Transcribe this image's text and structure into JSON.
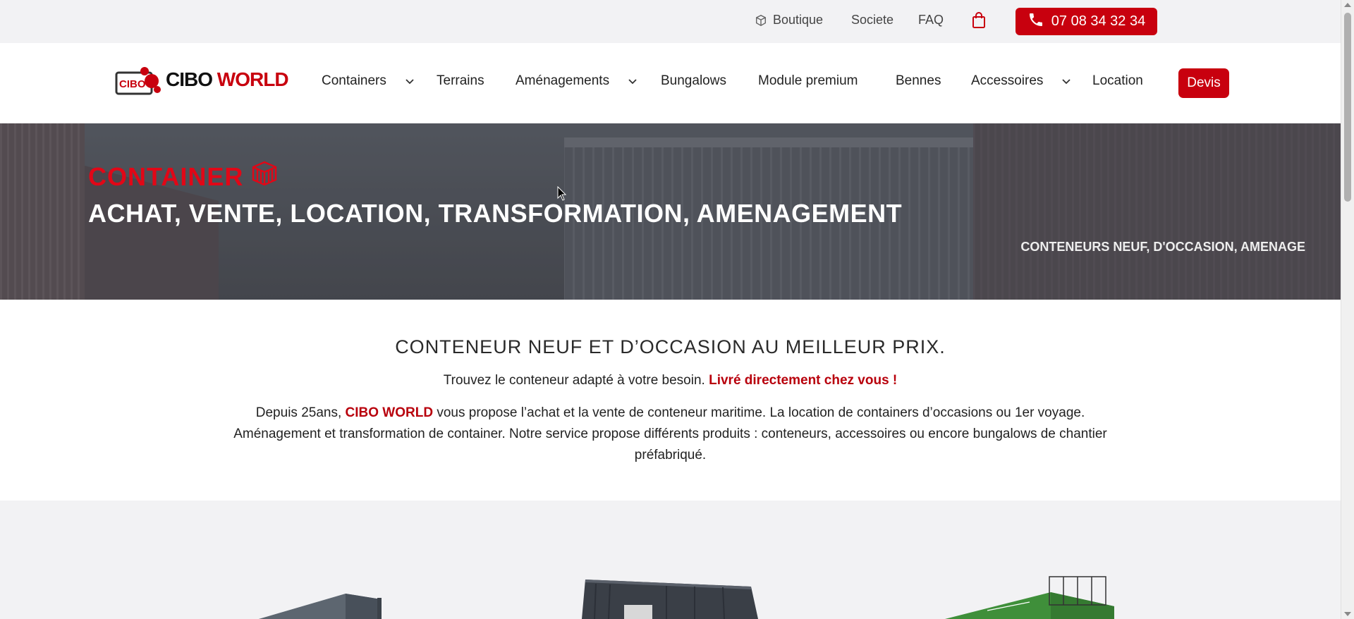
{
  "topbar": {
    "boutique_label": "Boutique",
    "societe_label": "Societe",
    "faq_label": "FAQ",
    "phone_label": "07 08 34 32 34"
  },
  "logo": {
    "badge_text": "CIBO",
    "word1": "CIBO",
    "word2": "WORLD"
  },
  "nav": {
    "items": [
      {
        "label": "Containers",
        "dropdown": true
      },
      {
        "label": "Terrains",
        "dropdown": false
      },
      {
        "label": "Aménagements",
        "dropdown": true
      },
      {
        "label": "Bungalows",
        "dropdown": false
      },
      {
        "label": "Module premium",
        "dropdown": false
      },
      {
        "label": "Bennes",
        "dropdown": false
      },
      {
        "label": "Accessoires",
        "dropdown": true
      },
      {
        "label": "Location",
        "dropdown": false
      }
    ],
    "devis_label": "Devis"
  },
  "hero": {
    "title": "CONTAINER",
    "subtitle": "ACHAT, VENTE, LOCATION, TRANSFORMATION, AMENAGEMENT",
    "tagline": "CONTENEURS NEUF, D'OCCASION, AMENAGE"
  },
  "intro": {
    "heading": "CONTENEUR NEUF ET D’OCCASION AU MEILLEUR PRIX.",
    "line1_plain": "Trouvez le conteneur adapté à votre besoin. ",
    "line1_red": "Livré directement chez vous !",
    "para_start": "Depuis 25ans, ",
    "para_brand": "CIBO WORLD",
    "para_rest": " vous propose l’achat et la vente de conteneur maritime. La location de containers d’occasions ou 1er voyage. Aménagement et transformation de container. Notre service propose différents produits : conteneurs, accessoires ou encore bungalows de chantier préfabriqué."
  },
  "colors": {
    "accent": "#c8000e",
    "hero_title": "#e10717",
    "text": "#222222"
  },
  "icons": {
    "boutique": "box-icon",
    "cart": "shopping-bag-icon",
    "phone": "phone-icon",
    "hero": "container-box-icon"
  }
}
